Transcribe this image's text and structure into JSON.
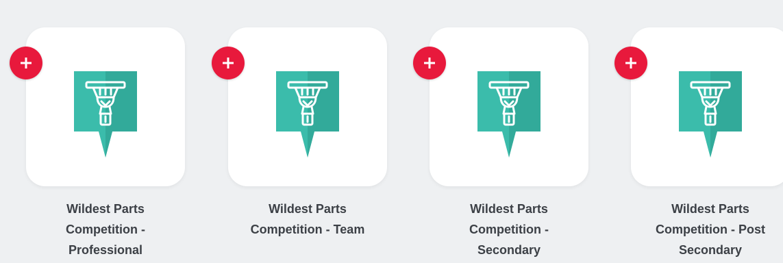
{
  "competitions": [
    {
      "name": "Wildest Parts\nCompetition -\nProfessional",
      "icon": "water-tower-marker-icon",
      "add_icon": "plus-icon"
    },
    {
      "name": "Wildest Parts\nCompetition - Team",
      "icon": "water-tower-marker-icon",
      "add_icon": "plus-icon"
    },
    {
      "name": "Wildest Parts\nCompetition -\nSecondary",
      "icon": "water-tower-marker-icon",
      "add_icon": "plus-icon"
    },
    {
      "name": "Wildest Parts\nCompetition - Post\nSecondary",
      "icon": "water-tower-marker-icon",
      "add_icon": "plus-icon"
    }
  ],
  "colors": {
    "background": "#eef0f2",
    "card": "#ffffff",
    "add_button": "#e8193c",
    "marker": "#3bbcab",
    "marker_shadow": "#2b9b8d",
    "label": "#3c4046"
  }
}
